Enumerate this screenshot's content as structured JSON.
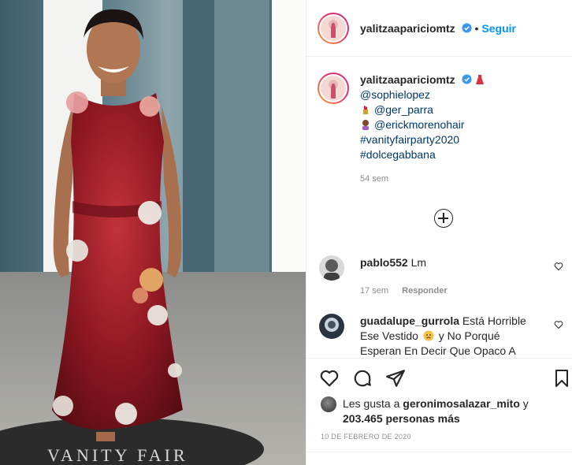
{
  "post": {
    "username": "yalitzaapariciomtz",
    "separator": "•",
    "follow_label": "Seguir"
  },
  "caption": {
    "username": "yalitzaapariciomtz",
    "lines": [
      "@sophielopez",
      "@ger_parra",
      "@erickmorenohair",
      "#vanityfairparty2020",
      "#dolcegabbana"
    ],
    "time": "54 sem"
  },
  "comments": [
    {
      "username": "pablo552",
      "text": "Lm",
      "time": "17 sem",
      "reply": "Responder"
    },
    {
      "username": "guadalupe_gurrola",
      "text_l1": "Está Horrible",
      "text_l2": "Ese Vestido",
      "text_l2b": "y No Porqué",
      "text_l3": "Esperan En Decir Que Opaco A"
    }
  ],
  "likes": {
    "prefix": "Les gusta a",
    "user": "geronimosalazar_mito",
    "conj": "y",
    "count": "203.465 personas más"
  },
  "date": "10 DE FEBRERO DE 2020",
  "photo_text": "VANITY FAIR",
  "colors": {
    "follow": "#0095f6",
    "tag": "#00376b",
    "meta": "#8e8e8e"
  },
  "icons": [
    "verified-icon",
    "dress-icon",
    "lipstick-icon",
    "hairdresser-icon",
    "plus-circle-icon",
    "heart-icon",
    "comment-icon",
    "share-icon",
    "bookmark-icon",
    "sad-face-icon"
  ]
}
